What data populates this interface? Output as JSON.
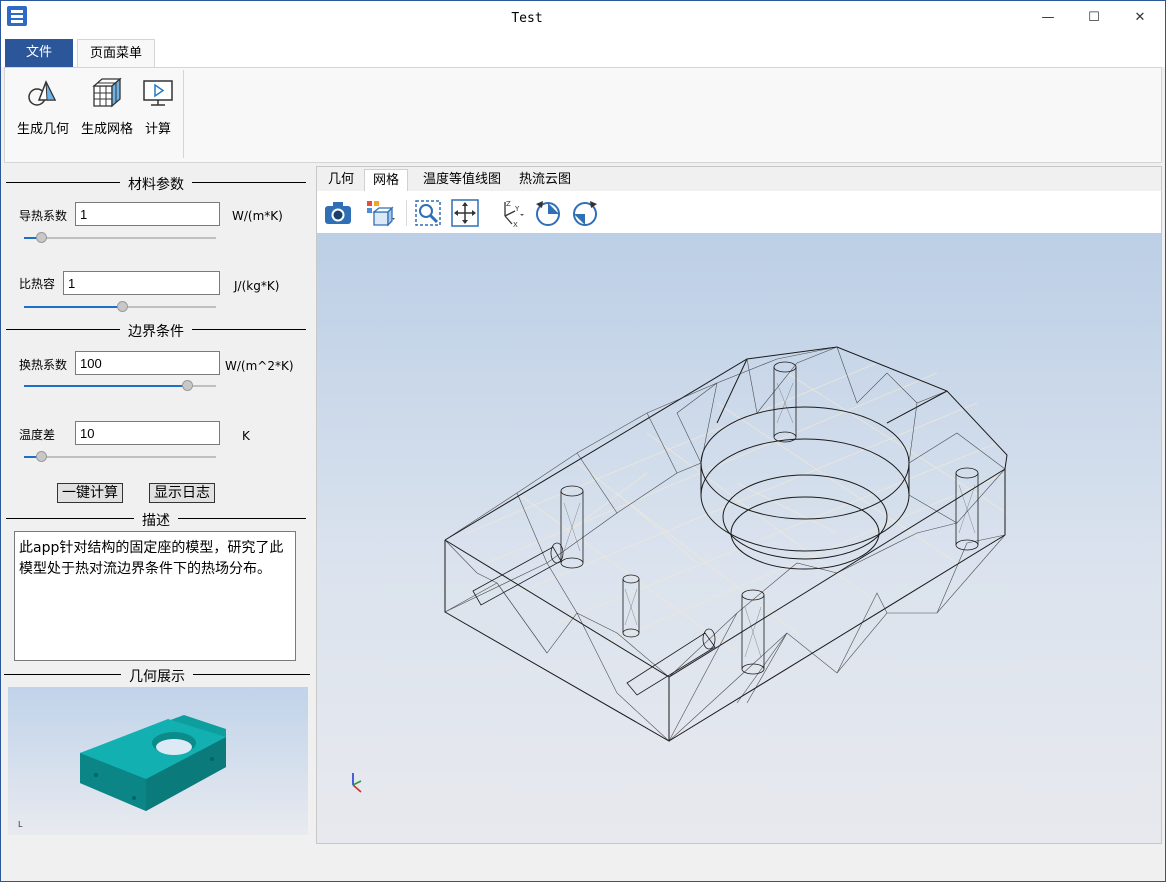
{
  "window": {
    "title": "Test",
    "minimize": "—",
    "maximize": "☐",
    "close": "✕"
  },
  "ribbon": {
    "tabs": [
      "文件",
      "页面菜单"
    ],
    "buttons": [
      {
        "label": "生成几何",
        "icon": "geometry-icon"
      },
      {
        "label": "生成网格",
        "icon": "mesh-cube-icon"
      },
      {
        "label": "计算",
        "icon": "monitor-play-icon"
      }
    ]
  },
  "left": {
    "material": {
      "title": "材料参数",
      "conductivity": {
        "label": "导热系数",
        "value": "1",
        "unit": "W/(m*K)",
        "slider": 0.09
      },
      "heat_capacity": {
        "label": "比热容",
        "value": "1",
        "unit": "J/(kg*K)",
        "slider": 0.51
      }
    },
    "boundary": {
      "title": "边界条件",
      "htc": {
        "label": "换热系数",
        "value": "100",
        "unit": "W/(m^2*K)",
        "slider": 0.85
      },
      "temp_diff": {
        "label": "温度差",
        "value": "10",
        "unit": "K",
        "slider": 0.09
      }
    },
    "buttons": {
      "compute": "一键计算",
      "show_log": "显示日志"
    },
    "description": {
      "title": "描述",
      "text": "此app针对结构的固定座的模型，研究了此模型处于热对流边界条件下的热场分布。"
    },
    "geometry_view": {
      "title": "几何展示"
    }
  },
  "viewer": {
    "tabs": [
      "几何",
      "网格",
      "温度等值线图",
      "热流云图"
    ],
    "active_tab": "网格",
    "toolbar": [
      "camera-icon",
      "display-mode-icon",
      "zoom-box-icon",
      "fit-view-icon",
      "axis-orientation-icon",
      "rotate-left-icon",
      "rotate-right-icon"
    ]
  }
}
